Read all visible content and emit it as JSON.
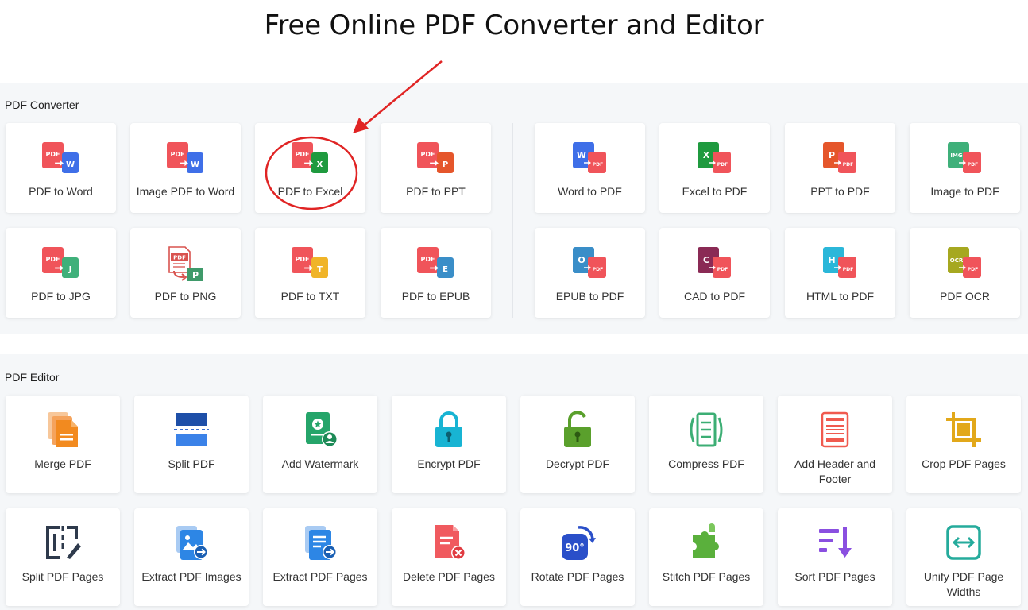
{
  "page": {
    "title": "Free Online PDF Converter and Editor"
  },
  "converter": {
    "label": "PDF Converter",
    "items": [
      {
        "label": "PDF to Word",
        "icon": "pdf-to-word-icon"
      },
      {
        "label": "Image PDF to Word",
        "icon": "image-pdf-to-word-icon"
      },
      {
        "label": "PDF to Excel",
        "icon": "pdf-to-excel-icon"
      },
      {
        "label": "PDF to PPT",
        "icon": "pdf-to-ppt-icon"
      },
      {
        "label": "Word to PDF",
        "icon": "word-to-pdf-icon"
      },
      {
        "label": "Excel to PDF",
        "icon": "excel-to-pdf-icon"
      },
      {
        "label": "PPT to PDF",
        "icon": "ppt-to-pdf-icon"
      },
      {
        "label": "Image to PDF",
        "icon": "image-to-pdf-icon"
      },
      {
        "label": "PDF to JPG",
        "icon": "pdf-to-jpg-icon"
      },
      {
        "label": "PDF to PNG",
        "icon": "pdf-to-png-icon"
      },
      {
        "label": "PDF to TXT",
        "icon": "pdf-to-txt-icon"
      },
      {
        "label": "PDF to EPUB",
        "icon": "pdf-to-epub-icon"
      },
      {
        "label": "EPUB to PDF",
        "icon": "epub-to-pdf-icon"
      },
      {
        "label": "CAD to PDF",
        "icon": "cad-to-pdf-icon"
      },
      {
        "label": "HTML to PDF",
        "icon": "html-to-pdf-icon"
      },
      {
        "label": "PDF OCR",
        "icon": "pdf-ocr-icon"
      }
    ]
  },
  "editor": {
    "label": "PDF Editor",
    "items": [
      {
        "label": "Merge PDF",
        "icon": "merge-pdf-icon"
      },
      {
        "label": "Split PDF",
        "icon": "split-pdf-icon"
      },
      {
        "label": "Add Watermark",
        "icon": "watermark-icon"
      },
      {
        "label": "Encrypt PDF",
        "icon": "lock-icon"
      },
      {
        "label": "Decrypt PDF",
        "icon": "unlock-icon"
      },
      {
        "label": "Compress PDF",
        "icon": "compress-icon"
      },
      {
        "label": "Add Header and Footer",
        "icon": "header-footer-icon"
      },
      {
        "label": "Crop PDF Pages",
        "icon": "crop-icon"
      },
      {
        "label": "Split PDF Pages",
        "icon": "split-pages-icon"
      },
      {
        "label": "Extract PDF Images",
        "icon": "extract-images-icon"
      },
      {
        "label": "Extract PDF Pages",
        "icon": "extract-pages-icon"
      },
      {
        "label": "Delete PDF Pages",
        "icon": "delete-pages-icon"
      },
      {
        "label": "Rotate PDF Pages",
        "icon": "rotate-icon"
      },
      {
        "label": "Stitch PDF Pages",
        "icon": "puzzle-icon"
      },
      {
        "label": "Sort PDF Pages",
        "icon": "sort-icon"
      },
      {
        "label": "Unify PDF Page Widths",
        "icon": "unify-width-icon"
      }
    ]
  },
  "icon_glyphs": {
    "pdf": "PDF",
    "w": "W",
    "x": "X",
    "p": "P",
    "j": "J",
    "t": "T",
    "e": "E",
    "o": "O",
    "c": "C",
    "h": "H",
    "img": "IMG",
    "ocr": "OCR",
    "ninety": "90°"
  },
  "colors": {
    "pdf_red": "#f0545a",
    "word_blue": "#3f6fe8",
    "excel_green": "#1f9a3f",
    "ppt_orange": "#e5562b",
    "jpg_green": "#3fb07a",
    "txt_yellow": "#f0b428",
    "epub_blue": "#3a8ec8",
    "cad_purple": "#8a2a55",
    "html_cyan": "#2bb7d9",
    "ocr_olive": "#a6a820",
    "annotation_red": "#e02424"
  }
}
